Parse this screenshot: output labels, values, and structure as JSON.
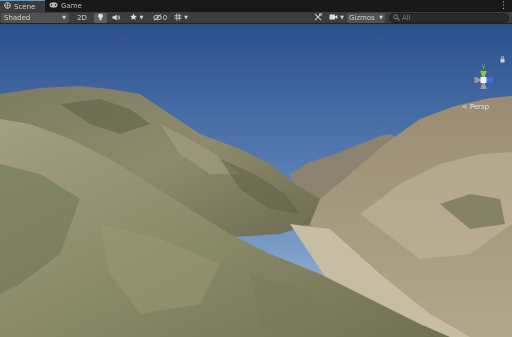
{
  "tabs": [
    {
      "label": "Scene",
      "icon": "scene-icon",
      "active": true
    },
    {
      "label": "Game",
      "icon": "game-icon",
      "active": false
    }
  ],
  "toolbar": {
    "shading_mode": "Shaded",
    "mode_2d_label": "2D",
    "hidden_objects_count": "0",
    "gizmos_label": "Gizmos",
    "search_placeholder": "All",
    "icons": [
      "lighting-icon",
      "audio-icon",
      "effects-icon",
      "visibility-icon",
      "grid-icon",
      "tools-icon",
      "camera-icon",
      "search-icon"
    ]
  },
  "scene_gizmo": {
    "projection_label": "Persp",
    "axes": {
      "y": "y",
      "x": "x"
    },
    "colors": {
      "x": "#dc3c32",
      "y": "#8ccd32",
      "z": "#3a72e8",
      "neutral": "#9c9c9c"
    }
  },
  "colors": {
    "tab_active_bar": "#5a9bd5",
    "toolbar_bg": "#3c3c3c",
    "sky_top": "#2c4f8e",
    "sky_horizon": "#a9c3dc"
  }
}
